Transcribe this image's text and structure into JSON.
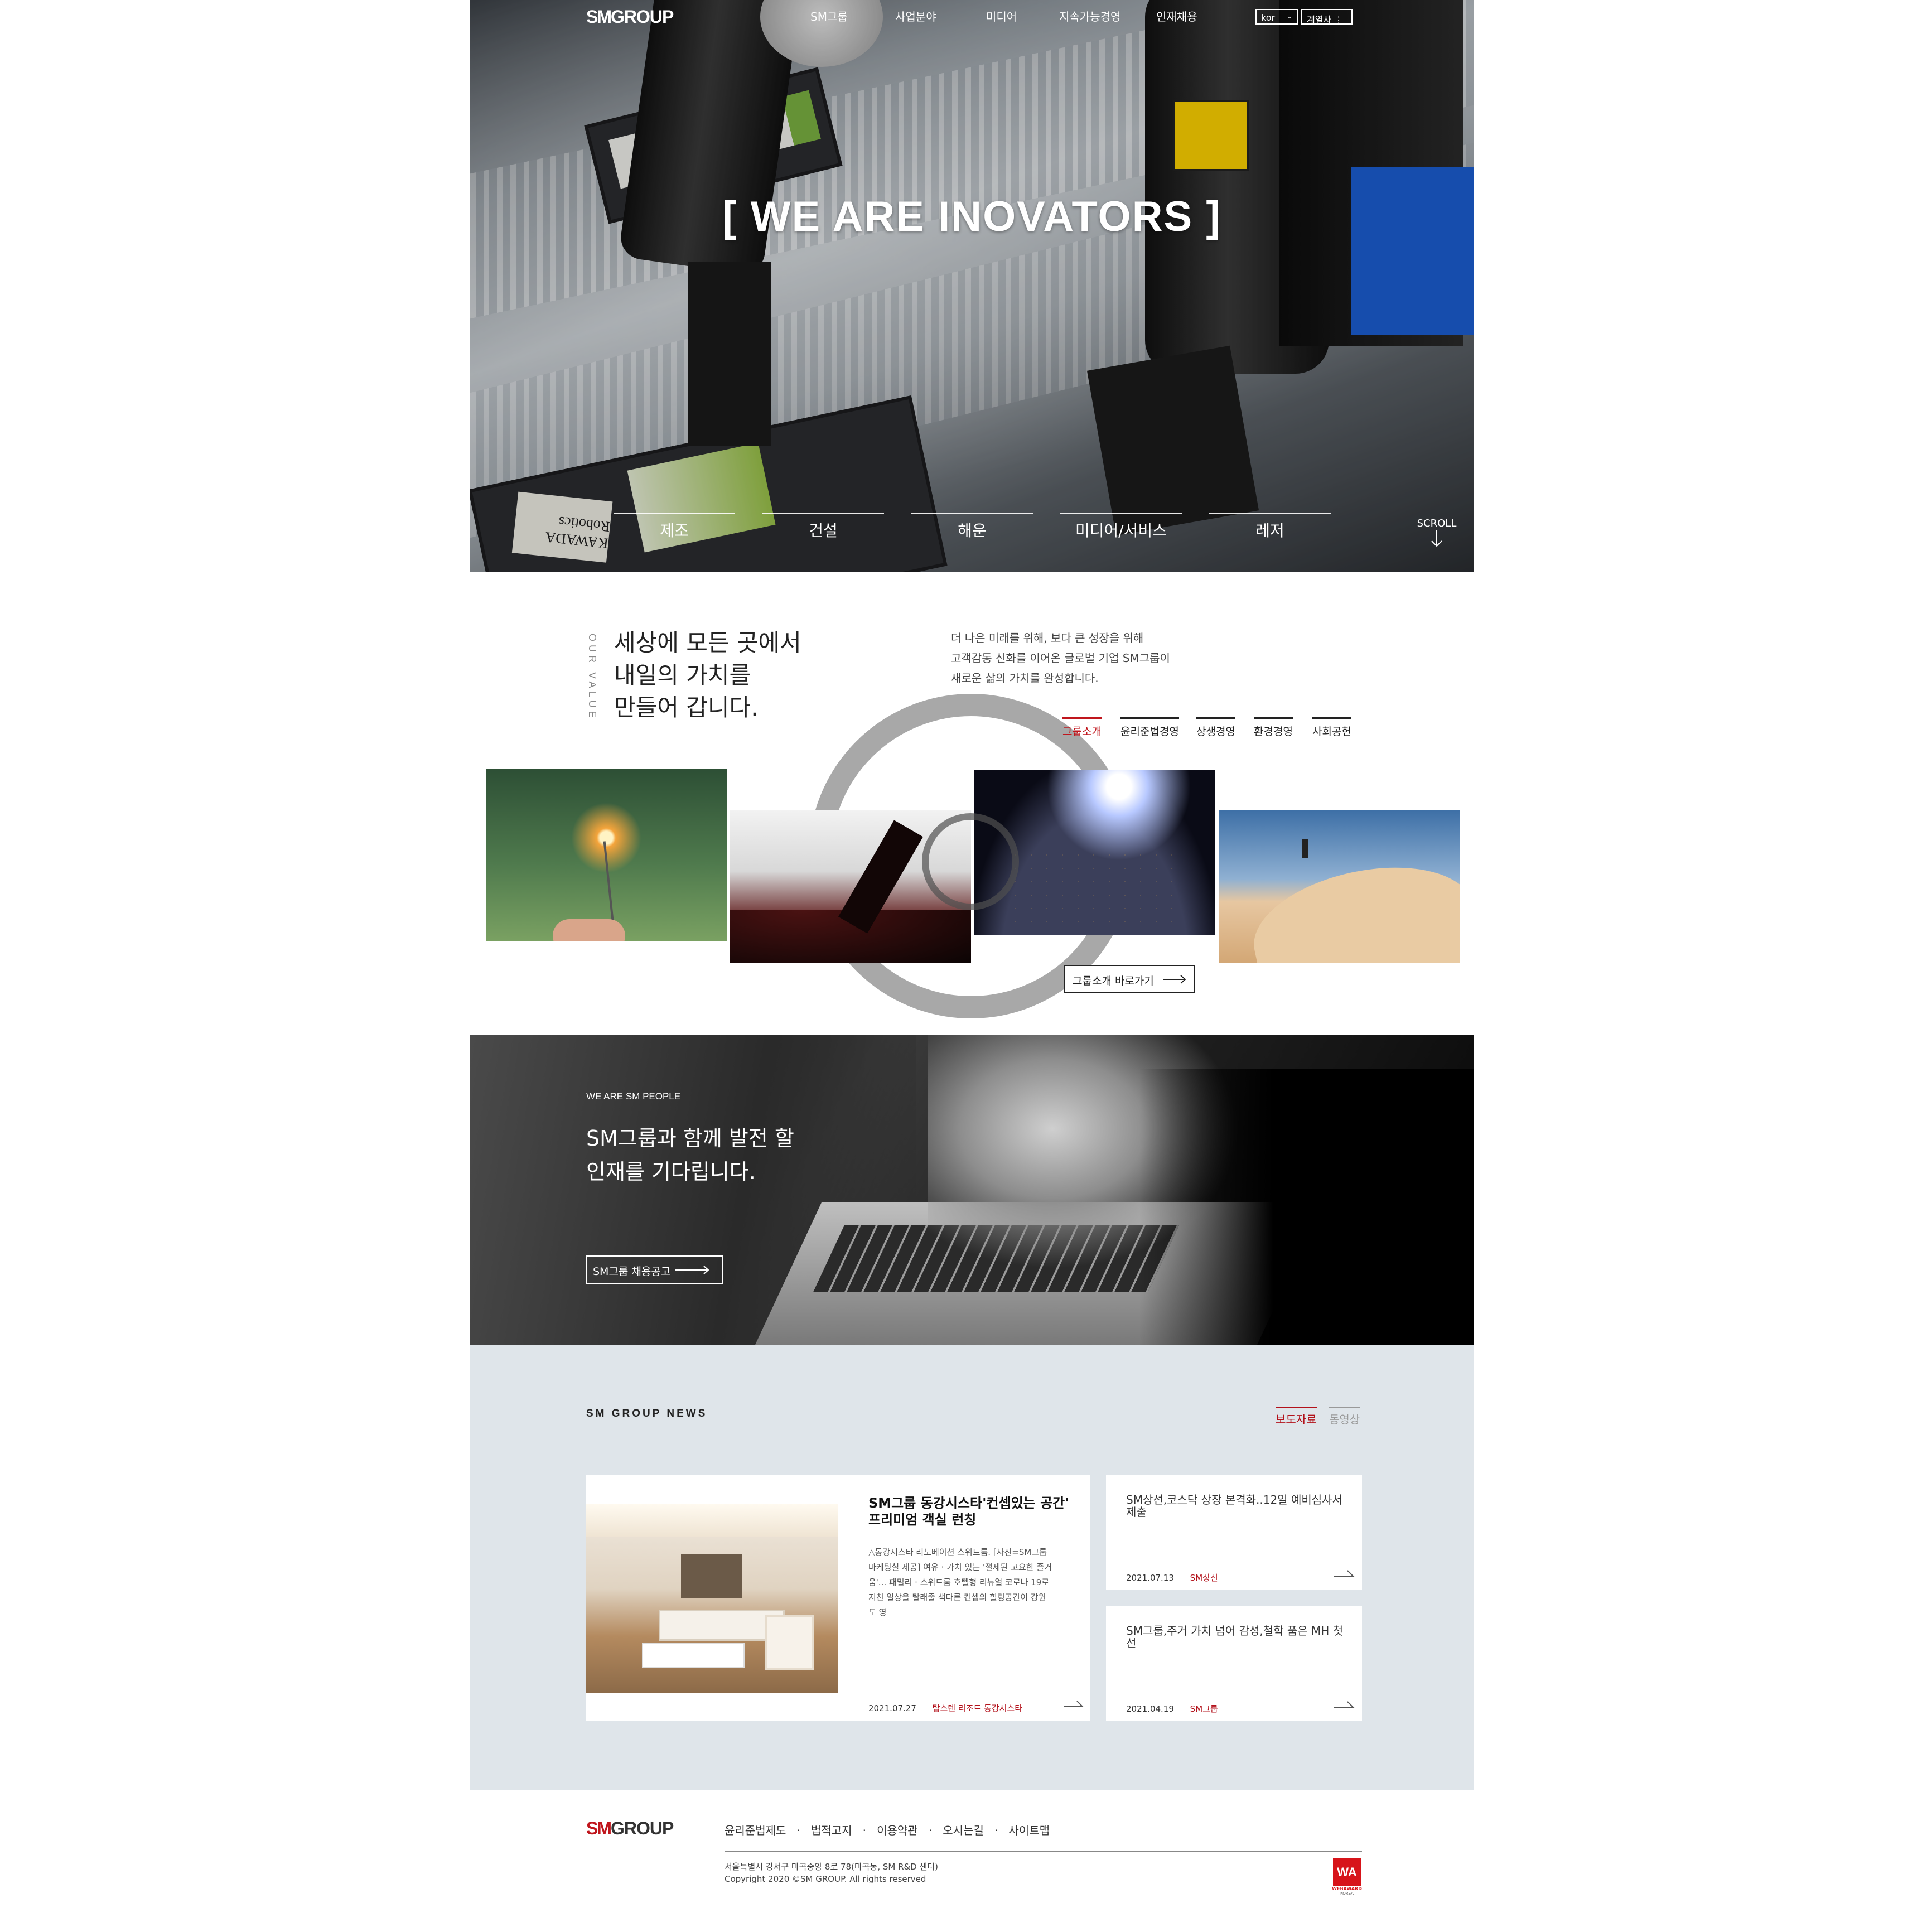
{
  "header": {
    "logo": {
      "sm": "SM",
      "group": "GROUP"
    },
    "nav": [
      "SM그룹",
      "사업분야",
      "미디어",
      "지속가능경영",
      "인재채용"
    ],
    "language": "kor",
    "affiliates_label": "계열사 ⋮"
  },
  "hero": {
    "title": "[ WE ARE INOVATORS ]",
    "categories": [
      "제조",
      "건설",
      "해운",
      "미디어/서비스",
      "레저"
    ],
    "scroll_label": "SCROLL",
    "robot_label": "KAWADA Robotics"
  },
  "value": {
    "vertical_label": "OUR VALUE",
    "heading_lines": [
      "세상에 모든 곳에서",
      "내일의 가치를",
      "만들어 갑니다."
    ],
    "description_lines": [
      "더 나은 미래를 위해, 보다 큰 성장을 위해",
      "고객감동 신화를 이어온 글로벌 기업 SM그룹이",
      "새로운 삶의 가치를 완성합니다."
    ],
    "tabs": [
      "그룹소개",
      "윤리준법경영",
      "상생경영",
      "환경경영",
      "사회공헌"
    ],
    "active_tab": "그룹소개",
    "cta_label": "그룹소개 바로가기"
  },
  "people": {
    "eyebrow": "WE ARE SM PEOPLE",
    "heading_lines": [
      "SM그룹과 함께 발전 할",
      "인재를 기다립니다."
    ],
    "cta_label": "SM그룹 채용공고"
  },
  "news": {
    "title": "SM GROUP NEWS",
    "tabs": [
      "보도자료",
      "동영상"
    ],
    "active_tab": "보도자료",
    "featured": {
      "title_lines": [
        "SM그룹 동강시스타'컨셉있는 공간'",
        "프리미엄 객실 런칭"
      ],
      "body_lines": [
        "△동강시스타 리노베이션 스위트룸. [사진=SM그룹",
        "마케팅실 제공] 여유 · 가치 있는 '절제된 고요한 즐거",
        "움'... 패밀리 · 스위트룸 호텔형 리뉴얼 코로나 19로",
        "지친 일상을 탈래줄 색다른 컨셉의 힐링공간이 강원",
        "도 영"
      ],
      "date": "2021.07.27",
      "source": "탑스텐 리조트 동강시스타"
    },
    "items": [
      {
        "title_lines": [
          "SM상선,코스닥 상장 본격화..12일 예비심사서",
          "제출"
        ],
        "date": "2021.07.13",
        "source": "SM상선"
      },
      {
        "title_lines": [
          "SM그룹,주거 가치 넘어 감성,철학 품은 MH 첫",
          "선"
        ],
        "date": "2021.04.19",
        "source": "SM그룹"
      }
    ]
  },
  "footer": {
    "logo": {
      "sm": "SM",
      "group": "GROUP"
    },
    "links": [
      "윤리준법제도",
      "법적고지",
      "이용약관",
      "오시는길",
      "사이트맵"
    ],
    "address": "서울특별시 강서구 마곡중앙 8로 78(마곡동, SM R&D 센터)",
    "copyright": "Copyright 2020 ©SM GROUP. All rights reserved",
    "award": {
      "badge": "WA",
      "text": "WEBAWARD",
      "sub": "KOREA"
    }
  },
  "colors": {
    "accent": "#c0161d",
    "news_bg": "#dfe5ea",
    "ring": "#a8a8a8"
  }
}
